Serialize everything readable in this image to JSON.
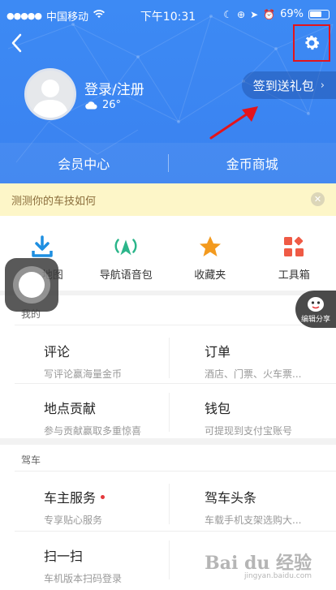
{
  "status_bar": {
    "carrier": "中国移动",
    "time": "下午10:31",
    "battery": "69%"
  },
  "header": {
    "login_label": "登录/注册",
    "temperature": "26°",
    "signin_label": "签到送礼包",
    "tabs": [
      "会员中心",
      "金币商城"
    ]
  },
  "notice": {
    "text": "测测你的车技如何"
  },
  "quick_actions": [
    {
      "label": "地图",
      "icon": "download-icon",
      "color": "#1e8fe1"
    },
    {
      "label": "导航语音包",
      "icon": "voice-broadcast-icon",
      "color": "#2bb58a"
    },
    {
      "label": "收藏夹",
      "icon": "star-icon",
      "color": "#f39a1e"
    },
    {
      "label": "工具箱",
      "icon": "toolbox-icon",
      "color": "#ef5a45"
    }
  ],
  "float_share": {
    "label": "编辑分享"
  },
  "mine": {
    "title": "我的",
    "items": [
      {
        "title": "评论",
        "subtitle": "写评论赢海量金币"
      },
      {
        "title": "订单",
        "subtitle": "酒店、门票、火车票..."
      },
      {
        "title": "地点贡献",
        "subtitle": "参与贡献赢取多重惊喜"
      },
      {
        "title": "钱包",
        "subtitle": "可提现到支付宝账号"
      }
    ]
  },
  "driving": {
    "title": "驾车",
    "items": [
      {
        "title": "车主服务",
        "subtitle": "专享贴心服务",
        "dot": true
      },
      {
        "title": "驾车头条",
        "subtitle": "车载手机支架选购大..."
      },
      {
        "title": "扫一扫",
        "subtitle": "车机版本扫码登录"
      }
    ]
  },
  "watermark": {
    "text": "Bai du 经验",
    "url": "jingyan.baidu.com"
  },
  "colors": {
    "header_blue": "#3b86f2",
    "highlight_red": "#e4141b",
    "notice_bg": "#fdf6c8"
  }
}
